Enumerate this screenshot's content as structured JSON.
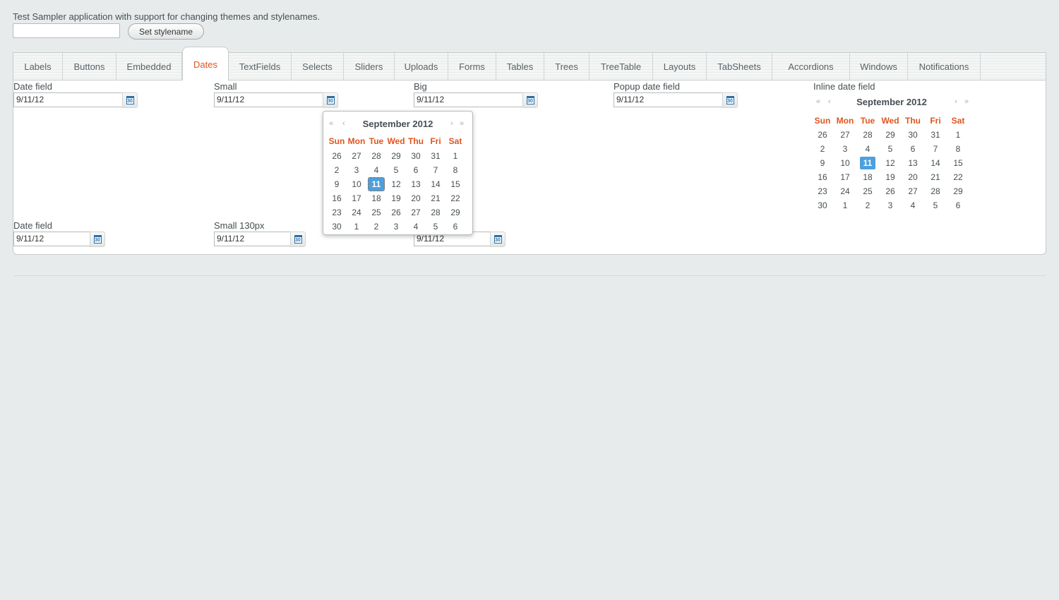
{
  "header": {
    "description": "Test Sampler application with support for changing themes and stylenames.",
    "stylename_value": "",
    "set_stylename_label": "Set stylename"
  },
  "tabs": [
    {
      "label": "Labels"
    },
    {
      "label": "Buttons"
    },
    {
      "label": "Embedded"
    },
    {
      "label": "Dates",
      "selected": true
    },
    {
      "label": "TextFields"
    },
    {
      "label": "Selects"
    },
    {
      "label": "Sliders"
    },
    {
      "label": "Uploads"
    },
    {
      "label": "Forms"
    },
    {
      "label": "Tables"
    },
    {
      "label": "Trees"
    },
    {
      "label": "TreeTable"
    },
    {
      "label": "Layouts"
    },
    {
      "label": "TabSheets"
    },
    {
      "label": "Accordions"
    },
    {
      "label": "Windows"
    },
    {
      "label": "Notifications"
    }
  ],
  "dates": {
    "date_field": {
      "caption": "Date field",
      "value": "9/11/12"
    },
    "small": {
      "caption": "Small",
      "value": "9/11/12"
    },
    "big": {
      "caption": "Big",
      "value": "9/11/12"
    },
    "popup": {
      "caption": "Popup date field",
      "value": "9/11/12"
    },
    "inline": {
      "caption": "Inline date field"
    },
    "date_field_2": {
      "caption": "Date field",
      "value": "9/11/12"
    },
    "small_130": {
      "caption": "Small 130px",
      "value": "9/11/12"
    },
    "third_row": {
      "value": "9/11/12"
    },
    "calendar_icon_text": "30"
  },
  "calendar": {
    "month_title": "September 2012",
    "day_names": [
      "Sun",
      "Mon",
      "Tue",
      "Wed",
      "Thu",
      "Fri",
      "Sat"
    ],
    "weeks": [
      [
        "26",
        "27",
        "28",
        "29",
        "30",
        "31",
        "1"
      ],
      [
        "2",
        "3",
        "4",
        "5",
        "6",
        "7",
        "8"
      ],
      [
        "9",
        "10",
        "11",
        "12",
        "13",
        "14",
        "15"
      ],
      [
        "16",
        "17",
        "18",
        "19",
        "20",
        "21",
        "22"
      ],
      [
        "23",
        "24",
        "25",
        "26",
        "27",
        "28",
        "29"
      ],
      [
        "30",
        "1",
        "2",
        "3",
        "4",
        "5",
        "6"
      ]
    ],
    "selected_day": "11",
    "nav": {
      "prev_year": "«",
      "prev_month": "‹",
      "next_month": "›",
      "next_year": "»"
    }
  }
}
